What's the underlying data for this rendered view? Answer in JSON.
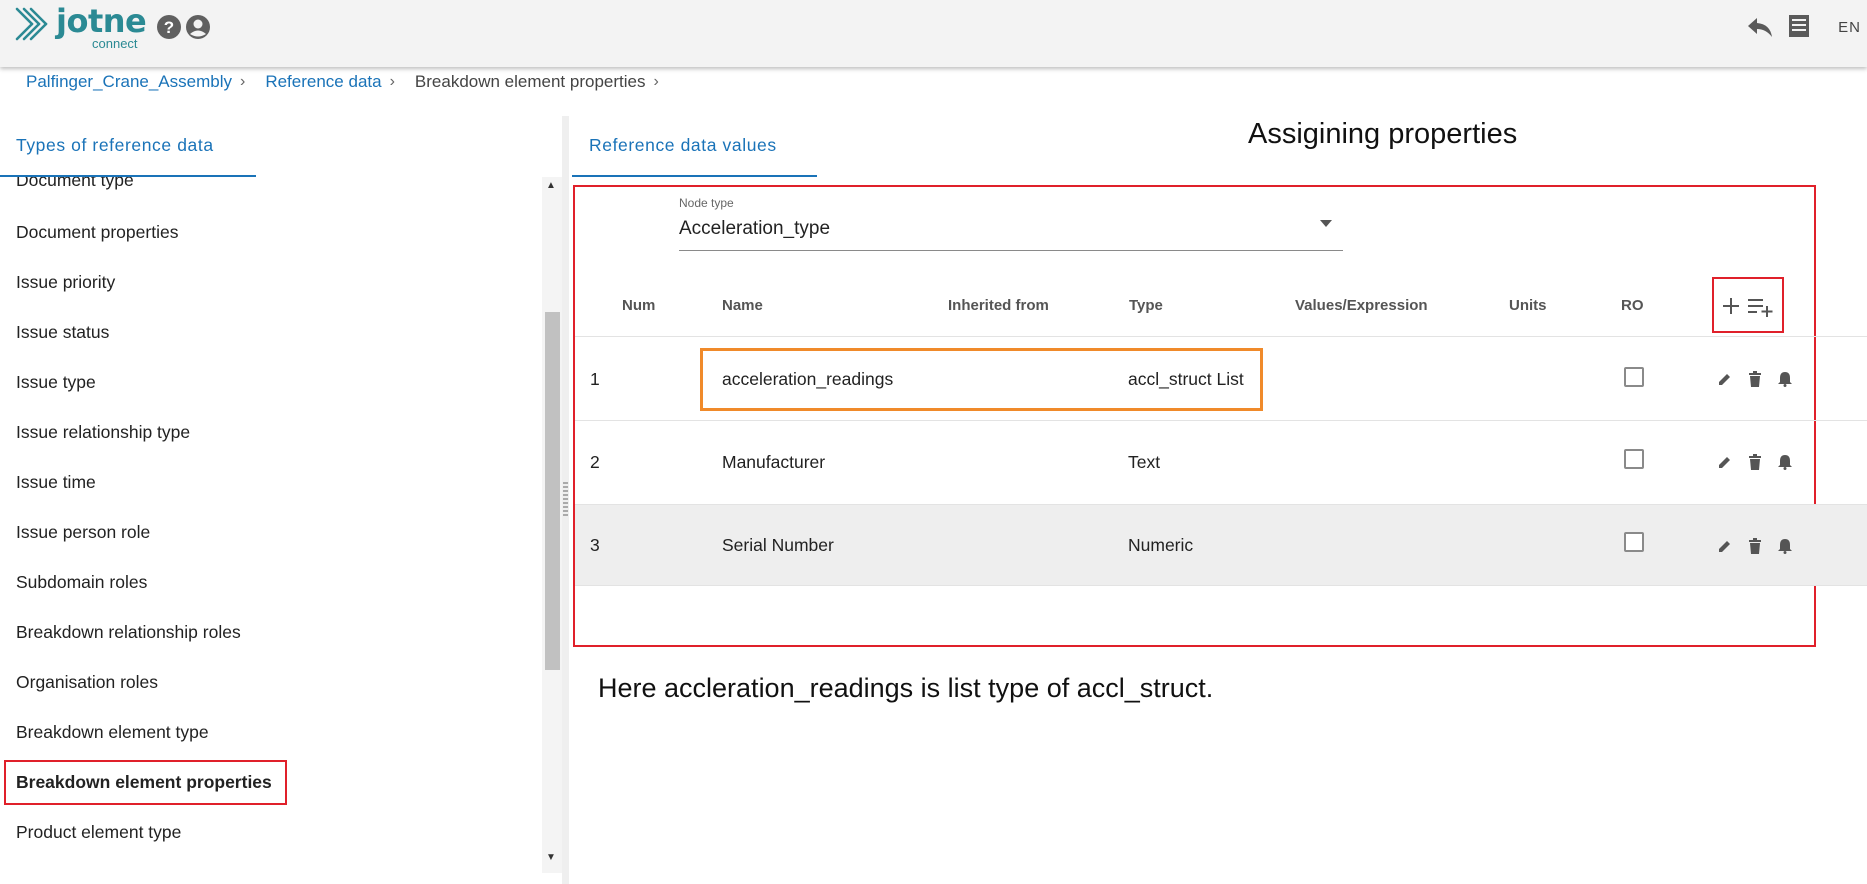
{
  "header": {
    "logo_text": "jotne",
    "logo_sub": "connect",
    "lang": "EN"
  },
  "breadcrumb": [
    {
      "label": "Palfinger_Crane_Assembly"
    },
    {
      "label": "Reference data"
    },
    {
      "label": "Breakdown element properties"
    }
  ],
  "left_panel": {
    "tab_label": "Types of reference data",
    "items": [
      "Document type",
      "Document properties",
      "Issue priority",
      "Issue status",
      "Issue type",
      "Issue relationship type",
      "Issue time",
      "Issue person role",
      "Subdomain roles",
      "Breakdown relationship roles",
      "Organisation roles",
      "Breakdown element type",
      "Breakdown element properties",
      "Product element type"
    ],
    "selected": "Breakdown element properties"
  },
  "right_panel": {
    "tab_label": "Reference data values",
    "annotation_title": "Assigining properties",
    "annotation_note": "Here accleration_readings is list type of accl_struct.",
    "node_type": {
      "label": "Node type",
      "value": "Acceleration_type"
    },
    "table": {
      "headers": [
        "Num",
        "Name",
        "Inherited from",
        "Type",
        "Values/Expression",
        "Units",
        "RO"
      ],
      "rows": [
        {
          "num": "1",
          "name": "acceleration_readings",
          "inherited": "",
          "type": "accl_struct List",
          "values": "",
          "units": "",
          "ro": false
        },
        {
          "num": "2",
          "name": "Manufacturer",
          "inherited": "",
          "type": "Text",
          "values": "",
          "units": "",
          "ro": false
        },
        {
          "num": "3",
          "name": "Serial Number",
          "inherited": "",
          "type": "Numeric",
          "values": "",
          "units": "",
          "ro": false
        }
      ]
    }
  },
  "icons": {
    "help": "help-circle-icon",
    "account": "account-circle-icon",
    "back": "reply-icon",
    "menu": "list-icon",
    "add": "plus-icon",
    "add_list": "playlist-add-icon",
    "edit": "pencil-icon",
    "delete": "trash-icon",
    "notify": "bell-icon"
  },
  "colors": {
    "brand": "#2b8a94",
    "link": "#1a73b8",
    "highlight_red": "#e0202a",
    "highlight_orange": "#f08a2a"
  }
}
